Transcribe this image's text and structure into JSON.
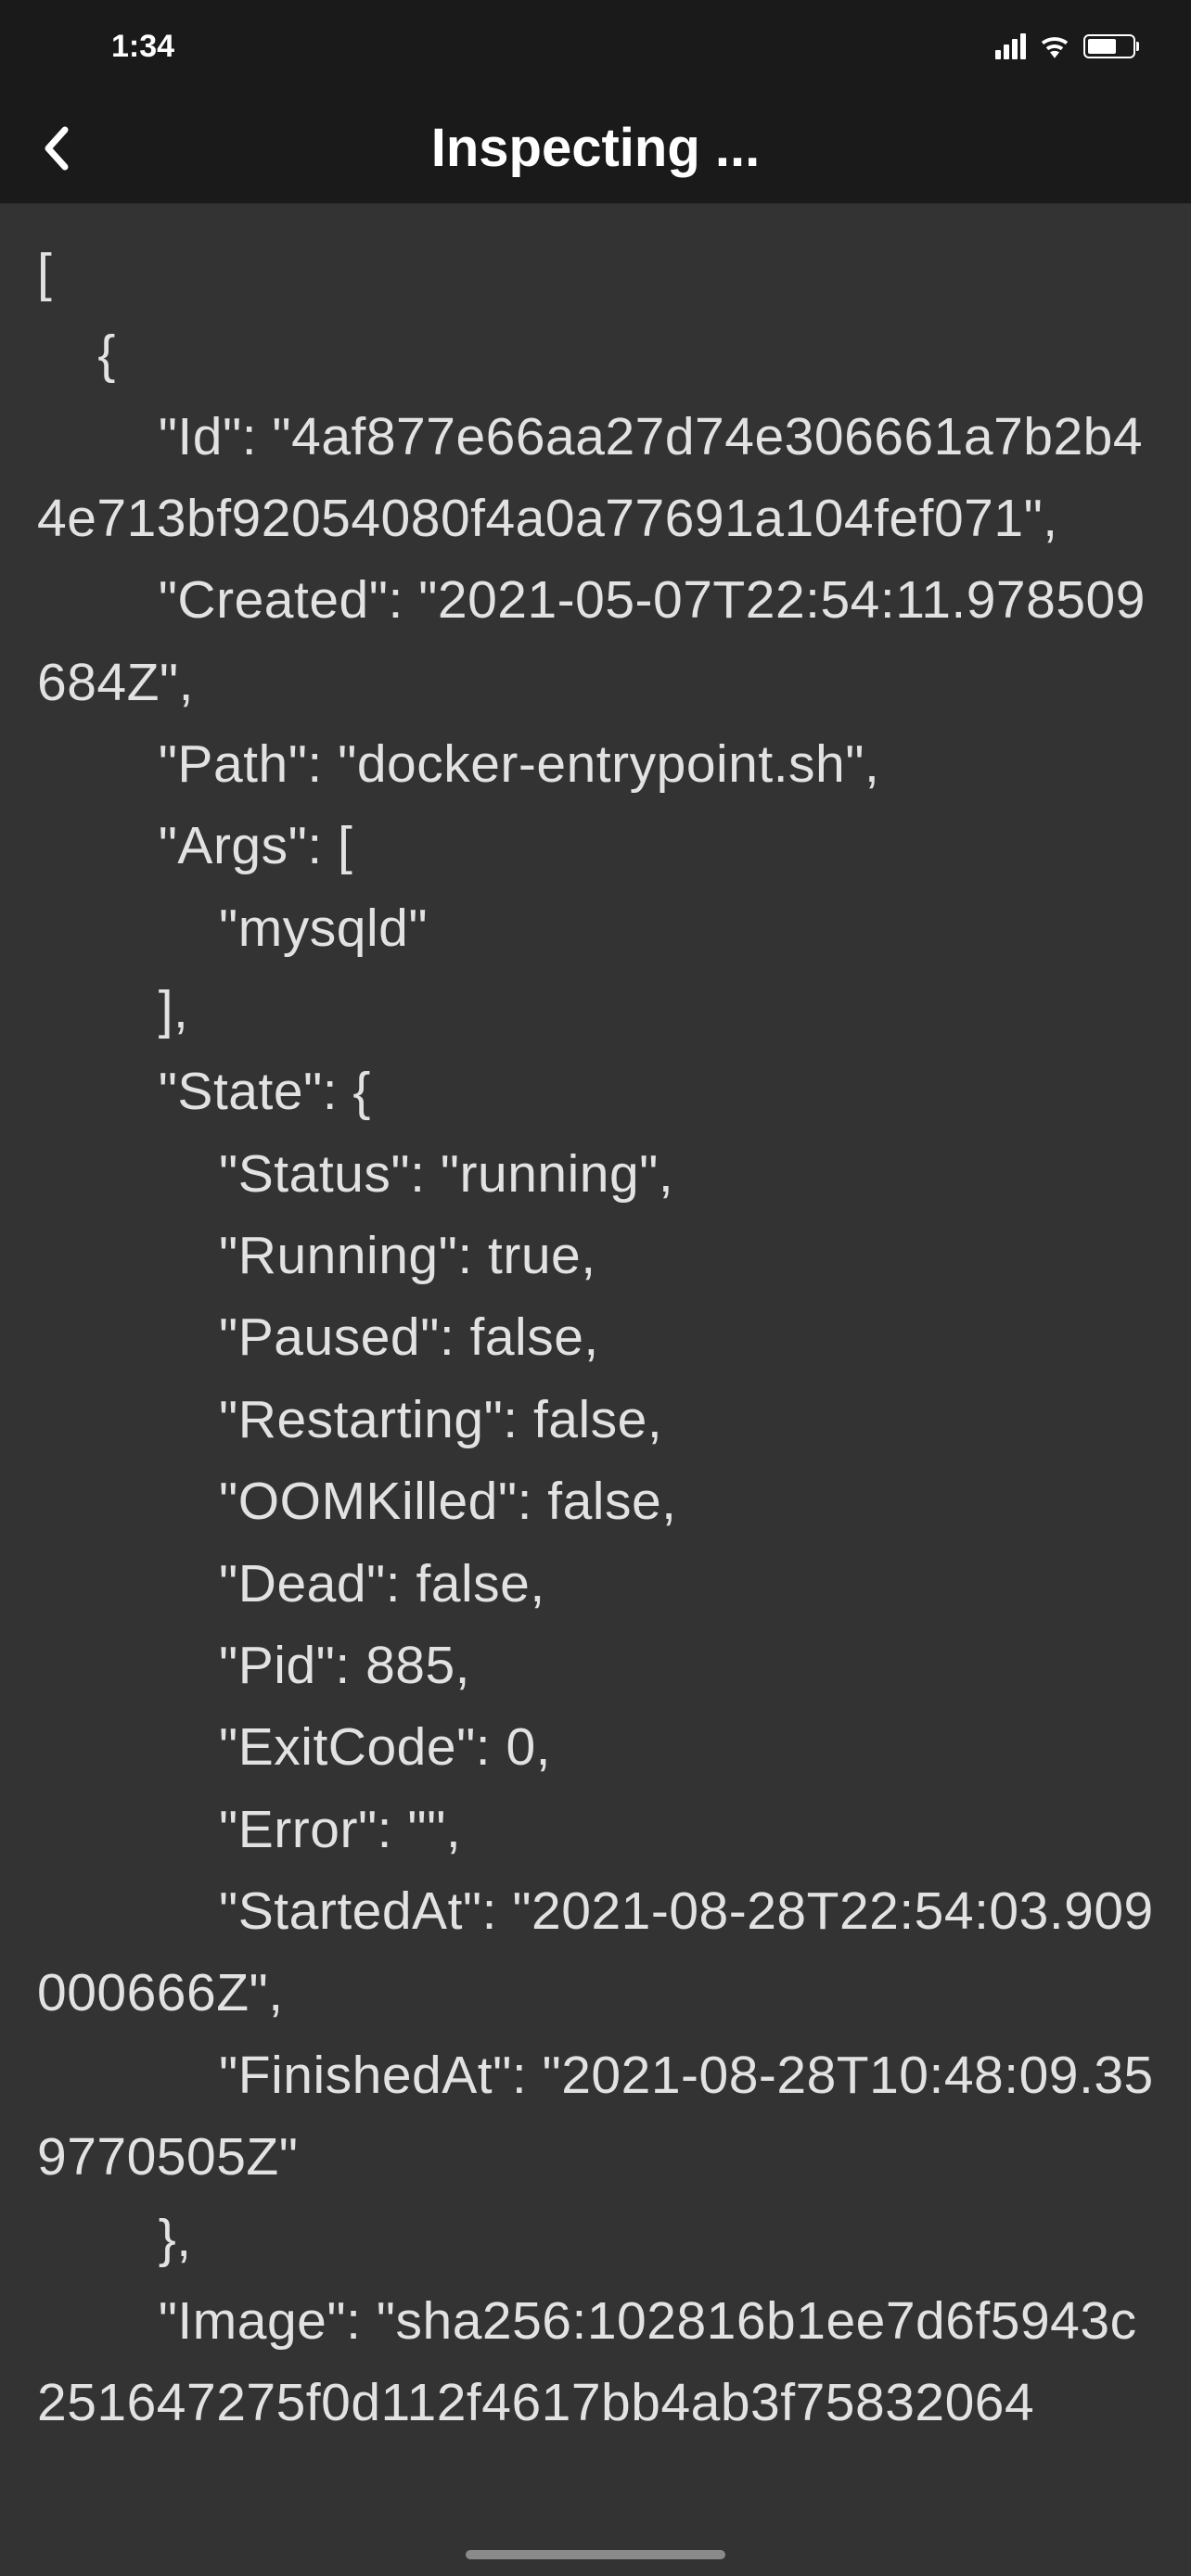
{
  "statusBar": {
    "time": "1:34"
  },
  "nav": {
    "title": "Inspecting ..."
  },
  "content": {
    "text": "[\n    {\n        \"Id\": \"4af877e66aa27d74e306661a7b2b44e713bf92054080f4a0a77691a104fef071\",\n        \"Created\": \"2021-05-07T22:54:11.978509684Z\",\n        \"Path\": \"docker-entrypoint.sh\",\n        \"Args\": [\n            \"mysqld\"\n        ],\n        \"State\": {\n            \"Status\": \"running\",\n            \"Running\": true,\n            \"Paused\": false,\n            \"Restarting\": false,\n            \"OOMKilled\": false,\n            \"Dead\": false,\n            \"Pid\": 885,\n            \"ExitCode\": 0,\n            \"Error\": \"\",\n            \"StartedAt\": \"2021-08-28T22:54:03.909000666Z\",\n            \"FinishedAt\": \"2021-08-28T10:48:09.359770505Z\"\n        },\n        \"Image\": \"sha256:102816b1ee7d6f5943c251647275f0d112f4617bb4ab3f75832064"
  }
}
